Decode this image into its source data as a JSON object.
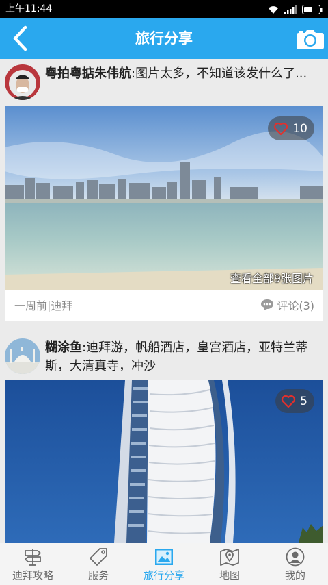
{
  "status_bar": {
    "time": "上午11:44"
  },
  "app_bar": {
    "title": "旅行分享"
  },
  "posts": [
    {
      "author": "粤拍粤掂朱伟航",
      "text": ":图片太多，不知道该发什么了...",
      "likes": "10",
      "view_all": "查看全部9张图片",
      "meta": "一周前|迪拜",
      "comments": "评论(3)"
    },
    {
      "author": "糊涂鱼",
      "text": ":迪拜游，帆船酒店，皇宫酒店，亚特兰蒂斯，大清真寺，冲沙",
      "likes": "5"
    }
  ],
  "tabs": [
    {
      "label": "迪拜攻略",
      "icon": "signpost-icon"
    },
    {
      "label": "服务",
      "icon": "tag-icon"
    },
    {
      "label": "旅行分享",
      "icon": "photo-icon"
    },
    {
      "label": "地图",
      "icon": "map-icon"
    },
    {
      "label": "我的",
      "icon": "profile-icon"
    }
  ],
  "active_tab": "旅行分享",
  "colors": {
    "accent": "#2aa8ee",
    "heart": "#e2302c"
  }
}
